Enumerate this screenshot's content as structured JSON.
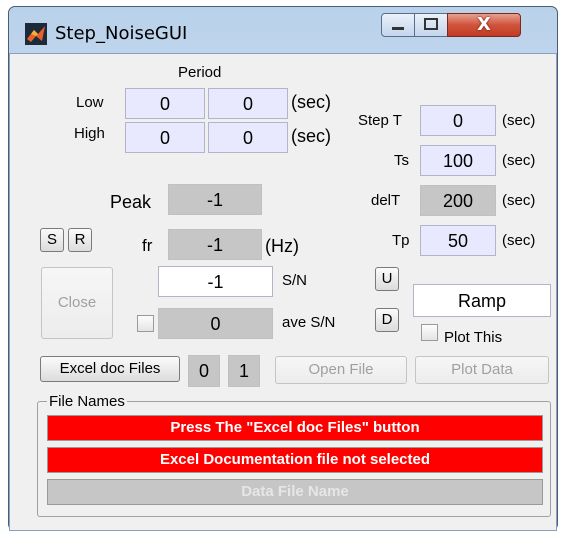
{
  "window": {
    "title": "Step_NoiseGUI",
    "close_glyph": "X",
    "icons": [
      "matlab-icon",
      "minimize-icon",
      "maximize-icon",
      "close-icon"
    ]
  },
  "period": {
    "label": "Period",
    "low_label": "Low",
    "high_label": "High",
    "low_values": [
      "0",
      "0"
    ],
    "high_values": [
      "0",
      "0"
    ],
    "unit": "(sec)"
  },
  "timing": {
    "step_t_label": "Step T",
    "step_t_value": "0",
    "ts_label": "Ts",
    "ts_value": "100",
    "delt_label": "delT",
    "delt_value": "200",
    "tp_label": "Tp",
    "tp_value": "50",
    "unit": "(sec)"
  },
  "signal": {
    "peak_label": "Peak",
    "peak_value": "-1",
    "fr_label": "fr",
    "fr_value": "-1",
    "fr_unit": "(Hz)",
    "sn_value": "-1",
    "sn_label": "S/N",
    "ave_sn_value": "0",
    "ave_sn_label": "ave S/N"
  },
  "buttons": {
    "s": "S",
    "r": "R",
    "u": "U",
    "d": "D",
    "close": "Close",
    "excel_doc_files": "Excel doc Files",
    "open_file": "Open File",
    "plot_data": "Plot Data"
  },
  "ramp": {
    "value": "Ramp",
    "plot_this_label": "Plot This"
  },
  "counters": [
    "0",
    "1"
  ],
  "file_names": {
    "legend": "File Names",
    "line1": "Press The \"Excel doc Files\" button",
    "line2": "Excel Documentation file not selected",
    "line3": "Data File Name"
  },
  "colors": {
    "edit_bg": "#e8e8ff",
    "readonly_bg": "#c6c6c6",
    "status_red": "#ff0000",
    "panel_bg": "#f0f0f0"
  }
}
